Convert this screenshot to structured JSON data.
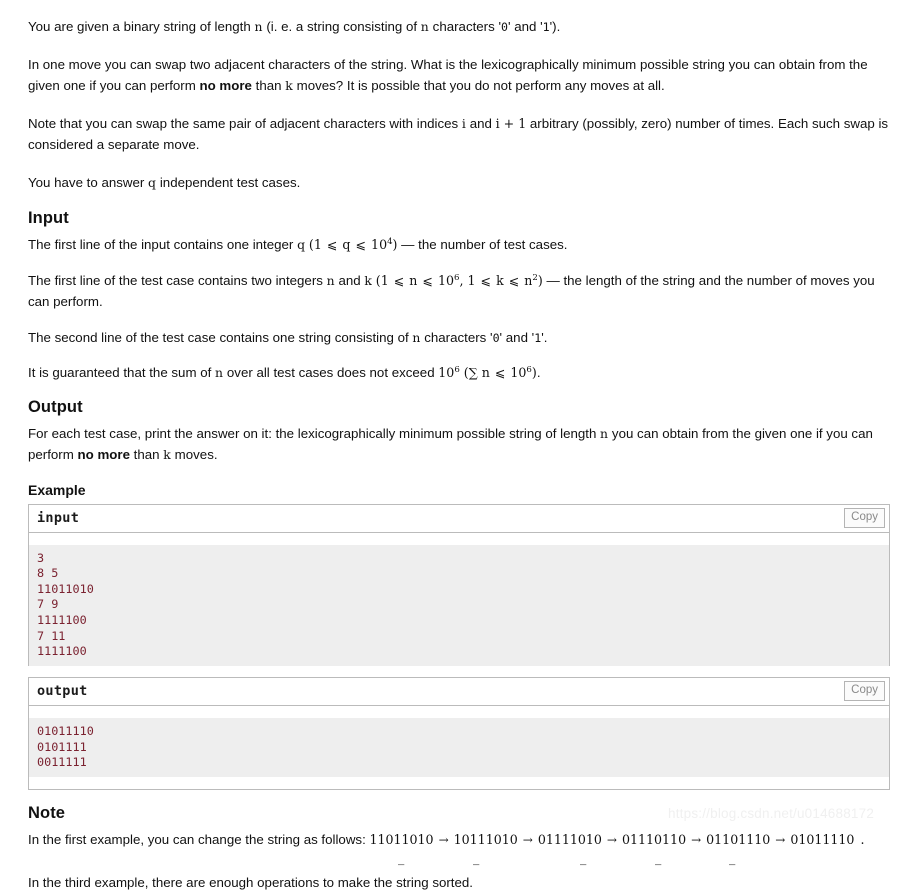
{
  "statement": {
    "p1_a": "You are given a binary string of length ",
    "p1_var_n": "n",
    "p1_b": " (i. e. a string consisting of ",
    "p1_var_n2": "n",
    "p1_c": " characters '",
    "p1_lit0": "0",
    "p1_d": "' and '",
    "p1_lit1": "1",
    "p1_e": "').",
    "p2_a": "In one move you can swap two adjacent characters of the string. What is the lexicographically minimum possible string you can obtain from the given one if you can perform ",
    "p2_bold": "no more",
    "p2_b": " than ",
    "p2_var_k": "k",
    "p2_c": " moves? It is possible that you do not perform any moves at all.",
    "p3_a": "Note that you can swap the same pair of adjacent characters with indices ",
    "p3_var_i": "i",
    "p3_b": " and ",
    "p3_var_i1": "i + 1",
    "p3_c": " arbitrary (possibly, zero) number of times. Each such swap is considered a separate move.",
    "p4_a": "You have to answer ",
    "p4_var_q": "q",
    "p4_b": " independent test cases."
  },
  "input_section": {
    "heading": "Input",
    "l1_a": "The first line of the input contains one integer ",
    "l1_var_q": "q",
    "l1_math_open": "(1 ",
    "l1_le1": "⩽",
    "l1_math_q": " q ",
    "l1_le2": "⩽",
    "l1_math_base": " 10",
    "l1_math_exp": "4",
    "l1_math_close": ")",
    "l1_b": " — the number of test cases.",
    "l2_a": "The first line of the test case contains two integers ",
    "l2_var_n": "n",
    "l2_and": " and ",
    "l2_var_k": "k",
    "l2_math_open": "(1 ",
    "l2_le1": "⩽",
    "l2_math_n": " n ",
    "l2_le2": "⩽",
    "l2_math_base1": " 10",
    "l2_math_exp1": "6",
    "l2_math_mid": ", 1 ",
    "l2_le3": "⩽",
    "l2_math_k": " k ",
    "l2_le4": "⩽",
    "l2_math_base2": " n",
    "l2_math_exp2": "2",
    "l2_math_close": ")",
    "l2_b": " — the length of the string and the number of moves you can perform.",
    "l3_a": "The second line of the test case contains one string consisting of ",
    "l3_var_n": "n",
    "l3_b": " characters '",
    "l3_lit0": "0",
    "l3_c": "' and '",
    "l3_lit1": "1",
    "l3_d": "'.",
    "l4_a": "It is guaranteed that the sum of ",
    "l4_var_n": "n",
    "l4_b": " over all test cases does not exceed ",
    "l4_math_base": "10",
    "l4_math_exp": "6",
    "l4_paren_open": " (",
    "l4_sum": "∑ n ",
    "l4_le": "⩽",
    "l4_math_base2": " 10",
    "l4_math_exp2": "6",
    "l4_paren_close": ")",
    "l4_c": "."
  },
  "output_section": {
    "heading": "Output",
    "l1_a": "For each test case, print the answer on it: the lexicographically minimum possible string of length ",
    "l1_var_n": "n",
    "l1_b": " you can obtain from the given one if you can perform ",
    "l1_bold": "no more",
    "l1_c": " than ",
    "l1_var_k": "k",
    "l1_d": " moves."
  },
  "example": {
    "heading": "Example",
    "input_panel": {
      "title": "input",
      "copy_label": "Copy",
      "content": "3\n8 5\n11011010\n7 9\n1111100\n7 11\n1111100"
    },
    "output_panel": {
      "title": "output",
      "copy_label": "Copy",
      "content": "01011110\n0101111\n0011111"
    }
  },
  "note": {
    "heading": "Note",
    "line1_prefix": "In the first example, you can change the string as follows: ",
    "chain": [
      "11011010",
      "10111010",
      "01111010",
      "01110110",
      "01101110",
      "01011110"
    ],
    "arrow": "→",
    "chain_suffix": ".",
    "underline_marks": [
      "_",
      "_",
      "_",
      "_",
      "_"
    ],
    "line2": "In the third example, there are enough operations to make the string sorted."
  },
  "watermark": {
    "text": "https://blog.csdn.net/u014688172"
  }
}
